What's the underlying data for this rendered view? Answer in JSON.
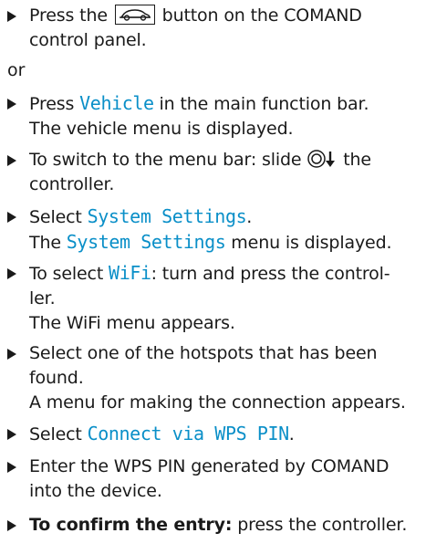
{
  "steps": [
    {
      "type": "bullet",
      "parts": {
        "before": "Press the ",
        "icon": "car-button-icon",
        "after": " button on the COMAND",
        "line2": "control panel."
      }
    },
    {
      "type": "plain",
      "text": "or"
    },
    {
      "type": "bullet",
      "parts": {
        "before": "Press ",
        "ui": "Vehicle",
        "after": " in the main function bar.",
        "line2": "The vehicle menu is displayed."
      }
    },
    {
      "type": "bullet",
      "parts": {
        "before": "To switch to the menu bar: slide ",
        "icon": "controller-slide-down-icon",
        "after": " the",
        "line2": "controller."
      }
    },
    {
      "type": "bullet",
      "parts": {
        "before": "Select ",
        "ui": "System Settings",
        "after": ".",
        "line2_before": "The ",
        "line2_ui": "System Settings",
        "line2_after": " menu is displayed."
      }
    },
    {
      "type": "bullet",
      "parts": {
        "before": "To select ",
        "ui": "WiFi",
        "after": ": turn and press the control-",
        "line2": "ler.",
        "line3": "The WiFi menu appears."
      }
    },
    {
      "type": "bullet",
      "parts": {
        "before": "Select one of the hotspots that has been",
        "line2": "found.",
        "line3": "A menu for making the connection appears."
      }
    },
    {
      "type": "bullet",
      "parts": {
        "before": "Select ",
        "ui": "Connect via WPS PIN",
        "after": "."
      }
    },
    {
      "type": "bullet",
      "parts": {
        "before": "Enter the WPS PIN generated by COMAND",
        "line2": "into the device."
      }
    },
    {
      "type": "bullet",
      "parts": {
        "strong": "To confirm the entry:",
        "after": " press the controller."
      }
    }
  ]
}
